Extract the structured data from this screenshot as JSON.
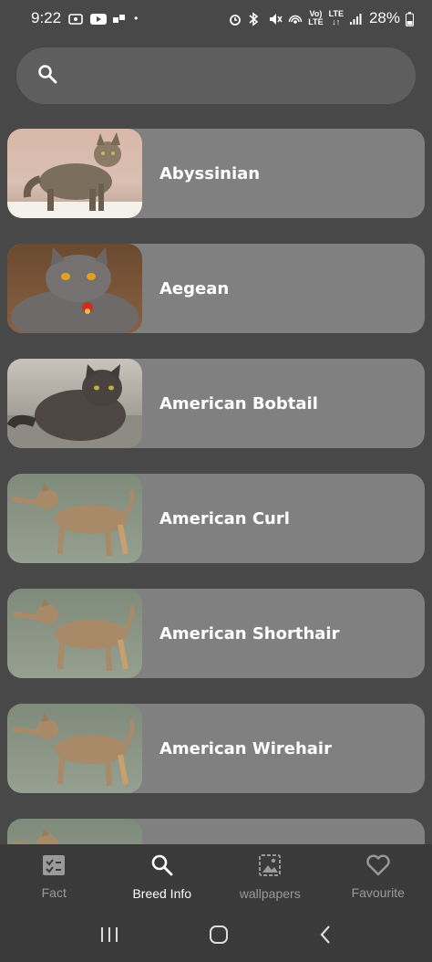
{
  "status_bar": {
    "time": "9:22",
    "battery": "28%",
    "network_top": "Vo)",
    "network_bottom": "LTE",
    "lte_top": "LTE",
    "lte_bottom": "↓↑",
    "dot": "•"
  },
  "search": {
    "placeholder": "",
    "icon": "search-icon"
  },
  "breeds": [
    {
      "name": "Abyssinian",
      "image": "cat-photo"
    },
    {
      "name": "Aegean",
      "image": "cat-photo"
    },
    {
      "name": "American Bobtail",
      "image": "cat-photo"
    },
    {
      "name": "American Curl",
      "image": "cat-photo"
    },
    {
      "name": "American Shorthair",
      "image": "cat-photo"
    },
    {
      "name": "American Wirehair",
      "image": "cat-photo"
    },
    {
      "name": "",
      "image": "cat-photo"
    }
  ],
  "bottom_nav": {
    "items": [
      {
        "label": "Fact",
        "icon": "fact-icon",
        "active": false
      },
      {
        "label": "Breed Info",
        "icon": "search-icon",
        "active": true
      },
      {
        "label": "wallpapers",
        "icon": "wallpaper-icon",
        "active": false
      },
      {
        "label": "Favourite",
        "icon": "heart-icon",
        "active": false
      }
    ]
  },
  "colors": {
    "background": "#484848",
    "card": "#808080",
    "search_bar": "#5e5e5e",
    "nav_bar": "#3a3a3a",
    "nav_active": "#ffffff",
    "nav_inactive": "#9a9a9a"
  }
}
